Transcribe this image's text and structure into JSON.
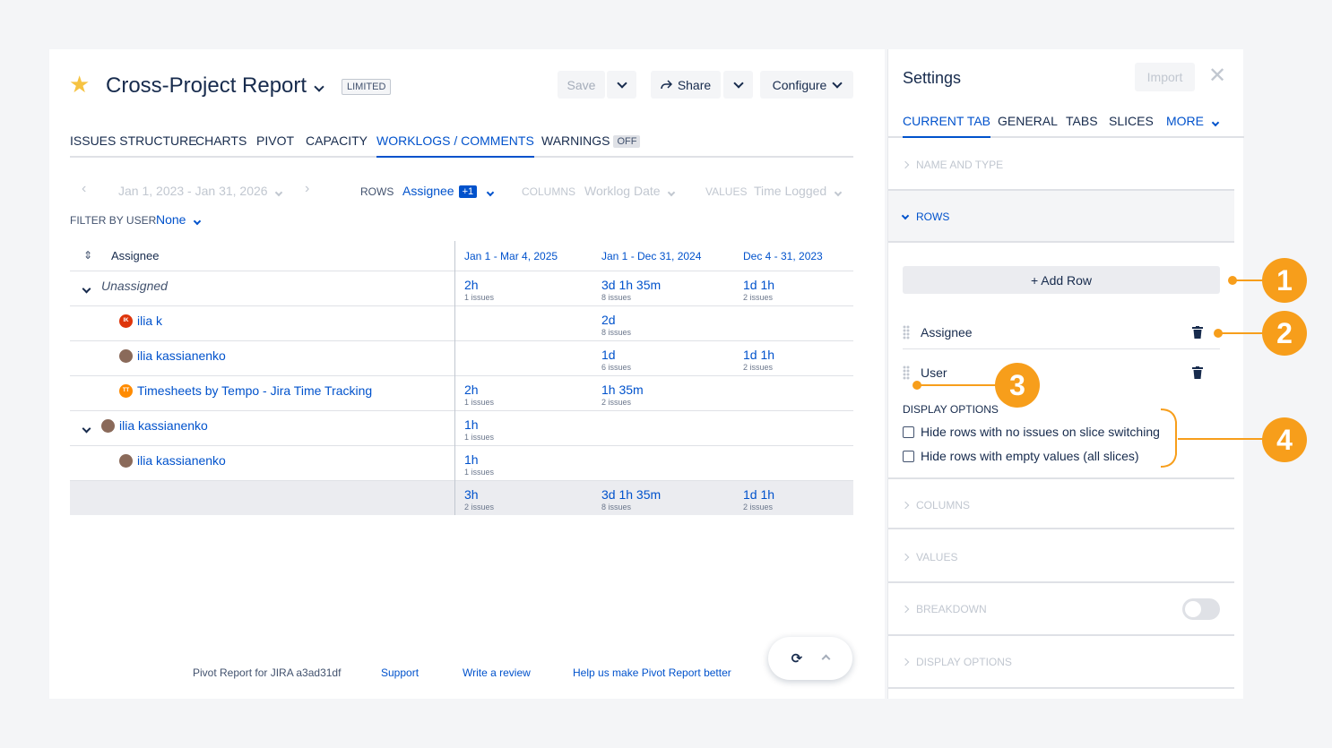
{
  "report": {
    "title": "Cross-Project Report",
    "badge": "LIMITED",
    "save_label": "Save",
    "share_label": "Share",
    "configure_label": "Configure"
  },
  "tabs": [
    {
      "label": "ISSUES STRUCTURE"
    },
    {
      "label": "CHARTS"
    },
    {
      "label": "PIVOT"
    },
    {
      "label": "CAPACITY"
    },
    {
      "label": "WORKLOGS / COMMENTS"
    },
    {
      "label": "WARNINGS",
      "badge": "OFF"
    }
  ],
  "controls": {
    "date_range": "Jan 1, 2023 - Jan 31, 2026",
    "rows_label": "ROWS",
    "rows_value": "Assignee",
    "rows_extra": "+1",
    "columns_label": "COLUMNS",
    "columns_value": "Worklog Date",
    "values_label": "VALUES",
    "values_value": "Time Logged",
    "filter_label": "FILTER BY USER",
    "filter_value": "None"
  },
  "table": {
    "header": "Assignee",
    "columns": [
      "Jan 1 - Mar 4, 2025",
      "Jan 1 - Dec 31, 2024",
      "Dec 4 - 31, 2023"
    ],
    "rows": [
      {
        "name": "Unassigned",
        "cells": [
          {
            "v": "2h",
            "s": "1 issues"
          },
          {
            "v": "3d 1h 35m",
            "s": "8 issues"
          },
          {
            "v": "1d 1h",
            "s": "2 issues"
          }
        ]
      },
      {
        "name": "ilia k",
        "avatar": "IK",
        "cells": [
          null,
          {
            "v": "2d",
            "s": "8 issues"
          },
          null
        ]
      },
      {
        "name": "ilia kassianenko",
        "cells": [
          null,
          {
            "v": "1d",
            "s": "6 issues"
          },
          {
            "v": "1d 1h",
            "s": "2 issues"
          }
        ]
      },
      {
        "name": "Timesheets by Tempo - Jira Time Tracking",
        "avatar": "TT",
        "cells": [
          {
            "v": "2h",
            "s": "1 issues"
          },
          {
            "v": "1h 35m",
            "s": "2 issues"
          },
          null
        ]
      },
      {
        "name": "ilia kassianenko",
        "cells": [
          {
            "v": "1h",
            "s": "1 issues"
          },
          null,
          null
        ]
      },
      {
        "name": "ilia kassianenko",
        "cells": [
          {
            "v": "1h",
            "s": "1 issues"
          },
          null,
          null
        ]
      },
      {
        "name": "",
        "cells": [
          {
            "v": "3h",
            "s": "2 issues"
          },
          {
            "v": "3d 1h 35m",
            "s": "8 issues"
          },
          {
            "v": "1d 1h",
            "s": "2 issues"
          }
        ]
      }
    ]
  },
  "footer": {
    "version": "Pivot Report for JIRA a3ad31df",
    "support": "Support",
    "review": "Write a review",
    "help": "Help us make Pivot Report better"
  },
  "settings": {
    "title": "Settings",
    "import_label": "Import",
    "tabs": [
      "CURRENT TAB",
      "GENERAL",
      "TABS",
      "SLICES",
      "MORE"
    ],
    "sections": {
      "name_type": "NAME AND TYPE",
      "rows": "ROWS",
      "columns": "COLUMNS",
      "values": "VALUES",
      "breakdown": "BREAKDOWN",
      "display_options": "DISPLAY OPTIONS"
    },
    "add_row": "+ Add Row",
    "row_items": [
      "Assignee",
      "User"
    ],
    "display_options_label": "DISPLAY OPTIONS",
    "checkboxes": [
      "Hide rows with no issues on slice switching",
      "Hide rows with empty values (all slices)"
    ],
    "breakdown_enabled": false
  },
  "callouts": [
    "1",
    "2",
    "3",
    "4"
  ],
  "colors": {
    "accent": "#0052cc",
    "callout": "#f79e1b",
    "star": "#f6c342"
  }
}
